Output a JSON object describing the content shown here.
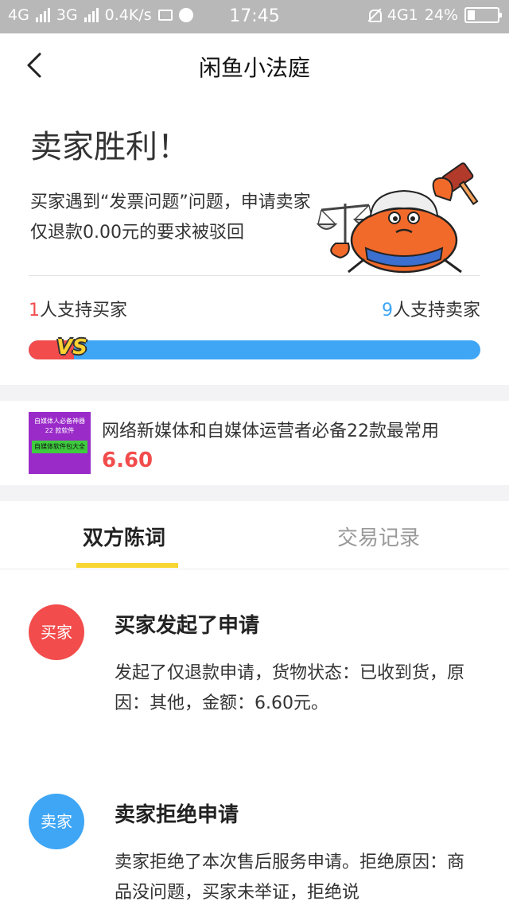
{
  "status_bar": {
    "sig1": "4G",
    "sig2": "3G",
    "speed": "0.4K/s",
    "time": "17:45",
    "net": "4G1",
    "battery": "24%",
    "battery_level": 0.24
  },
  "nav": {
    "title": "闲鱼小法庭"
  },
  "verdict": {
    "title": "卖家胜利！",
    "description": "买家遇到“发票问题”问题，申请卖家仅退款0.00元的要求被驳回"
  },
  "support": {
    "buyer_count": "1",
    "buyer_label": "人支持买家",
    "seller_count": "9",
    "seller_label": "人支持卖家",
    "buyer_fraction": 0.1,
    "vs": "VS"
  },
  "product": {
    "thumb_line1": "自媒体人必备神器",
    "thumb_line2": "22 款软件",
    "thumb_line3": "自媒体软件包大全",
    "title": "网络新媒体和自媒体运营者必备22款最常用",
    "price": "6.60"
  },
  "tabs": {
    "active": "双方陈词",
    "inactive": "交易记录"
  },
  "entries": [
    {
      "role": "买家",
      "title": "买家发起了申请",
      "text": "发起了仅退款申请，货物状态：已收到货，原因：其他，金额：6.60元。"
    },
    {
      "role": "卖家",
      "title": "卖家拒绝申请",
      "text": "卖家拒绝了本次售后服务申请。拒绝原因：商品没问题，买家未举证，拒绝说"
    }
  ],
  "colors": {
    "buyer_red": "#f24c4c",
    "seller_blue": "#3ea6f5",
    "tab_underline": "#f7d632"
  }
}
